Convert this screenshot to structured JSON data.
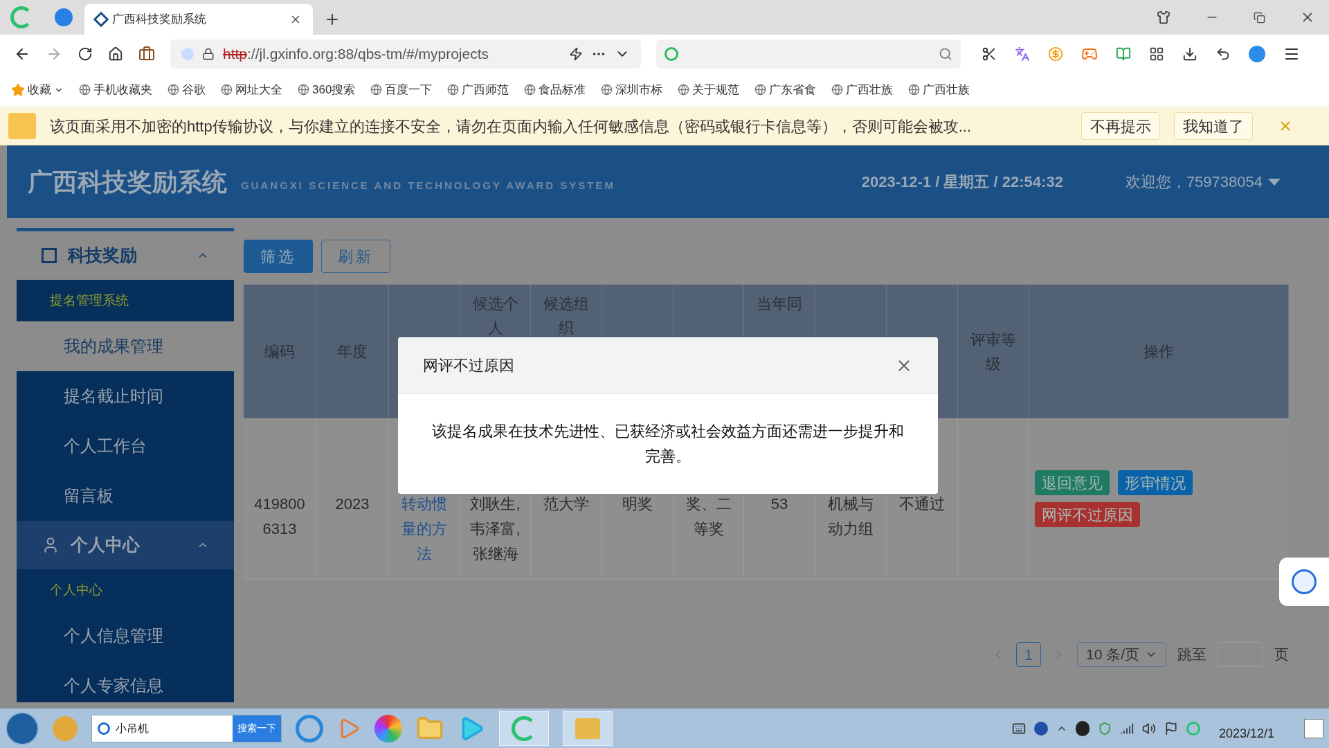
{
  "browser": {
    "tabs": [
      {
        "title": "广西科技奖励系统",
        "selected": true
      }
    ],
    "address": {
      "scheme": "http",
      "rest": "://jl.gxinfo.org:88/qbs-tm/#/myprojects"
    },
    "bookmarks": [
      "收藏",
      "手机收藏夹",
      "谷歌",
      "网址大全",
      "360搜索",
      "百度一下",
      "广西师范",
      "食品标准",
      "深圳市标",
      "关于规范",
      "广东省食",
      "广西壮族",
      "广西壮族"
    ]
  },
  "warning_bar": {
    "message": "该页面采用不加密的http传输协议，与你建立的连接不安全，请勿在页面内输入任何敏感信息（密码或银行卡信息等），否则可能会被攻...",
    "buttons": [
      "不再提示",
      "我知道了"
    ]
  },
  "header": {
    "title": "广西科技奖励系统",
    "subtitle": "GUANGXI SCIENCE AND TECHNOLOGY AWARD SYSTEM",
    "datetime": "2023-12-1 / 星期五 / 22:54:32",
    "user": "欢迎您，759738054"
  },
  "sidebar": {
    "sections": [
      {
        "kind": "board",
        "title": "科技奖励",
        "active": true,
        "expanded": true,
        "group": "提名管理系统",
        "items": [
          {
            "label": "我的成果管理",
            "selected": true
          },
          {
            "label": "提名截止时间",
            "selected": false
          },
          {
            "label": "个人工作台",
            "selected": false
          },
          {
            "label": "留言板",
            "selected": false
          }
        ]
      },
      {
        "kind": "user",
        "title": "个人中心",
        "active": false,
        "expanded": true,
        "group": "个人中心",
        "items": [
          {
            "label": "个人信息管理",
            "selected": false
          },
          {
            "label": "个人专家信息",
            "selected": false
          }
        ]
      }
    ]
  },
  "toolbar": [
    "筛选",
    "刷新"
  ],
  "table": {
    "columns": [
      {
        "label": "编码"
      },
      {
        "label": "年度"
      },
      {},
      {
        "label": "候选个人"
      },
      {
        "label": "候选组织"
      },
      {},
      {},
      {
        "label": "当年同"
      },
      {},
      {},
      {
        "label": "评审等级"
      },
      {
        "label": "操作"
      }
    ],
    "rows": [
      {
        "cells": [
          "4198006313",
          "2023",
          "转动惯量的方法",
          "刘耿生,韦泽富,张继海",
          "范大学",
          "明奖",
          "奖、二等奖",
          "53",
          "机械与动力组",
          "不通过",
          ""
        ],
        "actions": [
          {
            "label": "退回意见",
            "color": "#1e7a63"
          },
          {
            "label": "形审情况",
            "color": "#0a63a8"
          },
          {
            "label": "网评不过原因",
            "color": "#a8302f"
          }
        ]
      }
    ]
  },
  "pagination": {
    "pages": [
      {
        "label": "1",
        "selected": true
      }
    ],
    "page_size": "10 条/页",
    "jump_label": "跳至",
    "page_suffix": "页"
  },
  "dialog": {
    "title": "网评不过原因",
    "body": "该提名成果在技术先进性、已获经济或社会效益方面还需进一步提升和完善。"
  },
  "taskbar": {
    "search": "小吊机",
    "search_button": "搜索一下",
    "date": "2023/12/1"
  }
}
